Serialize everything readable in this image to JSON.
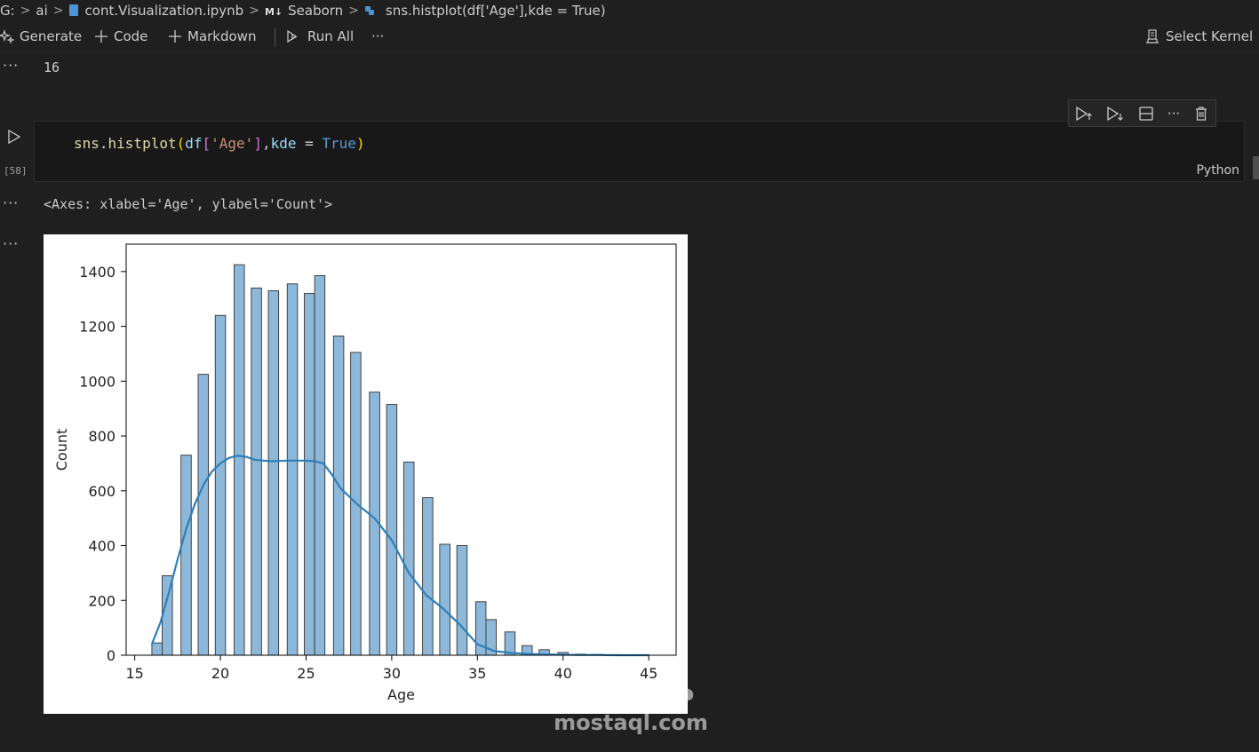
{
  "breadcrumb": {
    "drive": "G:",
    "folder": "ai",
    "notebook": "cont.Visualization.ipynb",
    "md_badge": "M↓",
    "section": "Seaborn",
    "cell": "sns.histplot(df['Age'],kde = True)"
  },
  "toolbar": {
    "generate": "Generate",
    "code": "Code",
    "markdown": "Markdown",
    "run_all": "Run All",
    "more": "···",
    "select_kernel": "Select Kernel"
  },
  "outputs": {
    "prev_value": "16",
    "ellipsis": "···",
    "axes_repr": "<Axes: xlabel='Age', ylabel='Count'>"
  },
  "cell": {
    "exec_count": "[58]",
    "language": "Python",
    "code_tokens": {
      "fn": "sns.histplot",
      "p1_open": "(",
      "df": "df",
      "p2_open": "[",
      "str": "'Age'",
      "p2_close": "]",
      "comma": ",",
      "kw_name": "kde",
      "eq": " = ",
      "kw_val": "True",
      "p1_close": ")"
    }
  },
  "chart_data": {
    "type": "bar",
    "title": "",
    "xlabel": "Age",
    "ylabel": "Count",
    "xlim": [
      14.5,
      46.6
    ],
    "ylim": [
      0,
      1500
    ],
    "xticks": [
      15,
      20,
      25,
      30,
      35,
      40,
      45
    ],
    "yticks": [
      0,
      200,
      400,
      600,
      800,
      1000,
      1200,
      1400
    ],
    "bar_color": "#8db8d9",
    "bar_edge": "#333333",
    "kde_color": "#2e7fba",
    "bins": [
      {
        "x0": 16.0,
        "x1": 16.6,
        "count": 45
      },
      {
        "x0": 16.6,
        "x1": 17.2,
        "count": 290
      },
      {
        "x0": 17.7,
        "x1": 18.3,
        "count": 730
      },
      {
        "x0": 18.7,
        "x1": 19.3,
        "count": 1025
      },
      {
        "x0": 19.7,
        "x1": 20.3,
        "count": 1240
      },
      {
        "x0": 20.8,
        "x1": 21.4,
        "count": 1425
      },
      {
        "x0": 21.8,
        "x1": 22.4,
        "count": 1340
      },
      {
        "x0": 22.8,
        "x1": 23.4,
        "count": 1330
      },
      {
        "x0": 23.9,
        "x1": 24.5,
        "count": 1355
      },
      {
        "x0": 24.9,
        "x1": 25.5,
        "count": 1320
      },
      {
        "x0": 25.5,
        "x1": 26.1,
        "count": 1385
      },
      {
        "x0": 26.6,
        "x1": 27.2,
        "count": 1165
      },
      {
        "x0": 27.6,
        "x1": 28.2,
        "count": 1105
      },
      {
        "x0": 28.7,
        "x1": 29.3,
        "count": 960
      },
      {
        "x0": 29.7,
        "x1": 30.3,
        "count": 915
      },
      {
        "x0": 30.7,
        "x1": 31.3,
        "count": 705
      },
      {
        "x0": 31.8,
        "x1": 32.4,
        "count": 575
      },
      {
        "x0": 32.8,
        "x1": 33.4,
        "count": 405
      },
      {
        "x0": 33.8,
        "x1": 34.4,
        "count": 400
      },
      {
        "x0": 34.9,
        "x1": 35.5,
        "count": 195
      },
      {
        "x0": 35.5,
        "x1": 36.1,
        "count": 130
      },
      {
        "x0": 36.6,
        "x1": 37.2,
        "count": 85
      },
      {
        "x0": 37.6,
        "x1": 38.2,
        "count": 35
      },
      {
        "x0": 38.6,
        "x1": 39.2,
        "count": 20
      },
      {
        "x0": 39.7,
        "x1": 40.3,
        "count": 10
      },
      {
        "x0": 40.7,
        "x1": 41.3,
        "count": 4
      },
      {
        "x0": 41.7,
        "x1": 42.3,
        "count": 3
      },
      {
        "x0": 42.8,
        "x1": 43.4,
        "count": 2
      },
      {
        "x0": 43.8,
        "x1": 44.4,
        "count": 1
      },
      {
        "x0": 44.4,
        "x1": 45.0,
        "count": 2
      }
    ],
    "kde": {
      "x": [
        16,
        16.5,
        17,
        17.5,
        18,
        18.5,
        19,
        19.5,
        20,
        20.5,
        21,
        21.5,
        22,
        22.5,
        23,
        24,
        25,
        25.5,
        26,
        26.5,
        27,
        28,
        29,
        30,
        31,
        32,
        33,
        34,
        35,
        36,
        37,
        38,
        39,
        40,
        41,
        42,
        43,
        44,
        45
      ],
      "y": [
        40,
        120,
        230,
        350,
        460,
        550,
        620,
        670,
        700,
        720,
        728,
        724,
        713,
        710,
        708,
        710,
        710,
        708,
        700,
        660,
        610,
        550,
        500,
        420,
        300,
        220,
        170,
        110,
        40,
        15,
        8,
        5,
        3,
        2,
        1,
        1,
        0,
        0,
        0
      ]
    }
  },
  "watermark": {
    "arabic": "مستقل",
    "latin": "mostaql.com"
  }
}
